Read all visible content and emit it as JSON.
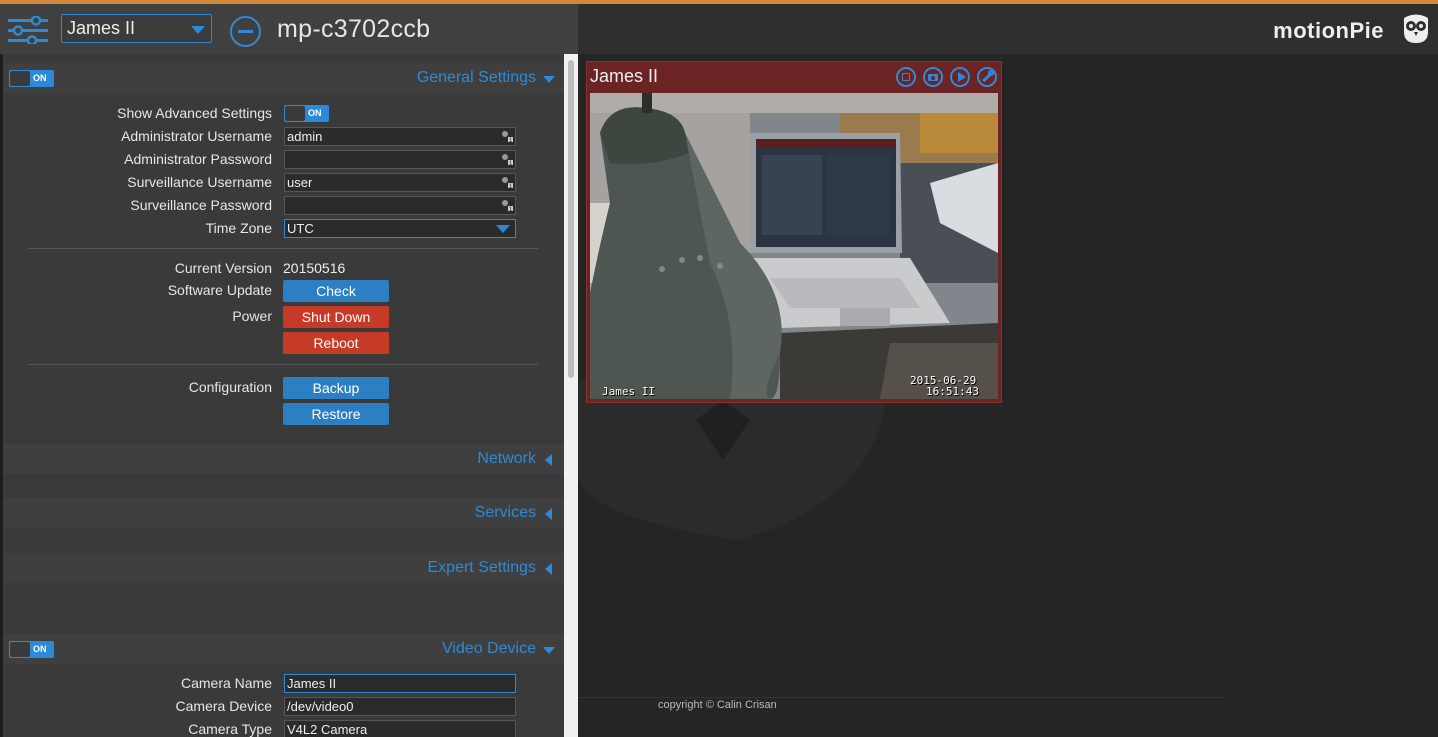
{
  "header": {
    "camera_selector": "James II",
    "hostname": "mp-c3702ccb",
    "brand": "motionPie"
  },
  "general_settings": {
    "title": "General Settings",
    "enabled_label": "ON",
    "fields": {
      "show_advanced": {
        "label": "Show Advanced Settings",
        "toggle_label": "ON"
      },
      "admin_username": {
        "label": "Administrator Username",
        "value": "admin"
      },
      "admin_password": {
        "label": "Administrator Password",
        "value": ""
      },
      "surv_username": {
        "label": "Surveillance Username",
        "value": "user"
      },
      "surv_password": {
        "label": "Surveillance Password",
        "value": ""
      },
      "time_zone": {
        "label": "Time Zone",
        "value": "UTC"
      }
    },
    "version": {
      "label": "Current Version",
      "value": "20150516"
    },
    "software_update": {
      "label": "Software Update",
      "button": "Check"
    },
    "power": {
      "label": "Power",
      "shutdown_button": "Shut Down",
      "reboot_button": "Reboot"
    },
    "configuration": {
      "label": "Configuration",
      "backup_button": "Backup",
      "restore_button": "Restore"
    }
  },
  "sections": {
    "network": "Network",
    "services": "Services",
    "expert": "Expert Settings"
  },
  "video_device": {
    "title": "Video Device",
    "enabled_label": "ON",
    "camera_name": {
      "label": "Camera Name",
      "value": "James II"
    },
    "camera_device": {
      "label": "Camera Device",
      "value": "/dev/video0"
    },
    "camera_type": {
      "label": "Camera Type",
      "value": "V4L2 Camera"
    }
  },
  "camera_frame": {
    "name": "James II",
    "osd_name": "James II",
    "osd_date": "2015-06-29",
    "osd_time": "16:51:43"
  },
  "footer": "copyright © Calin Crisan",
  "colors": {
    "accent": "#2d8ad8",
    "danger": "#c63a28",
    "frame": "#6b2323"
  }
}
